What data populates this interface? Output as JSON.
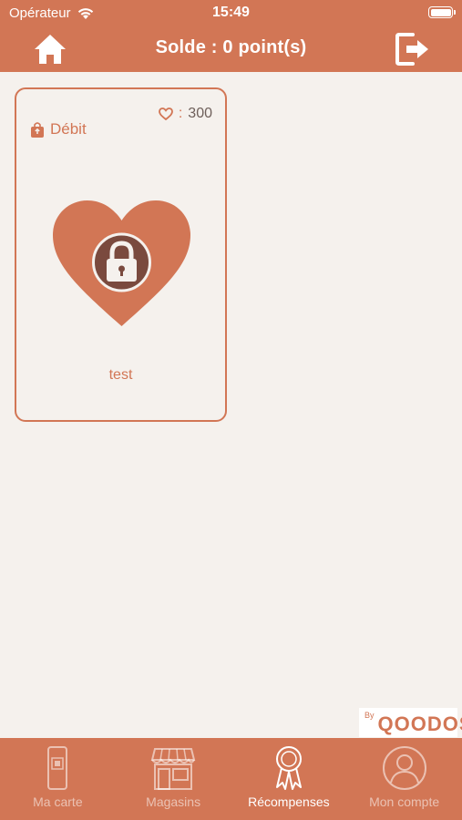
{
  "status_bar": {
    "carrier": "Opérateur",
    "time": "15:49"
  },
  "header": {
    "title": "Solde : 0 point(s)"
  },
  "card": {
    "points_separator": ":",
    "points": "300",
    "type_label": "Débit",
    "name": "test",
    "locked": true
  },
  "brand": {
    "by": "By",
    "name": "QOODOS"
  },
  "tabs": [
    {
      "label": "Ma carte",
      "icon": "phone-card-icon",
      "active": false
    },
    {
      "label": "Magasins",
      "icon": "store-icon",
      "active": false
    },
    {
      "label": "Récompenses",
      "icon": "medal-icon",
      "active": true
    },
    {
      "label": "Mon compte",
      "icon": "user-circle-icon",
      "active": false
    }
  ],
  "colors": {
    "primary": "#d27655",
    "background": "#f5f1ed",
    "lock_circle": "#7a4a3e",
    "white": "#ffffff"
  }
}
